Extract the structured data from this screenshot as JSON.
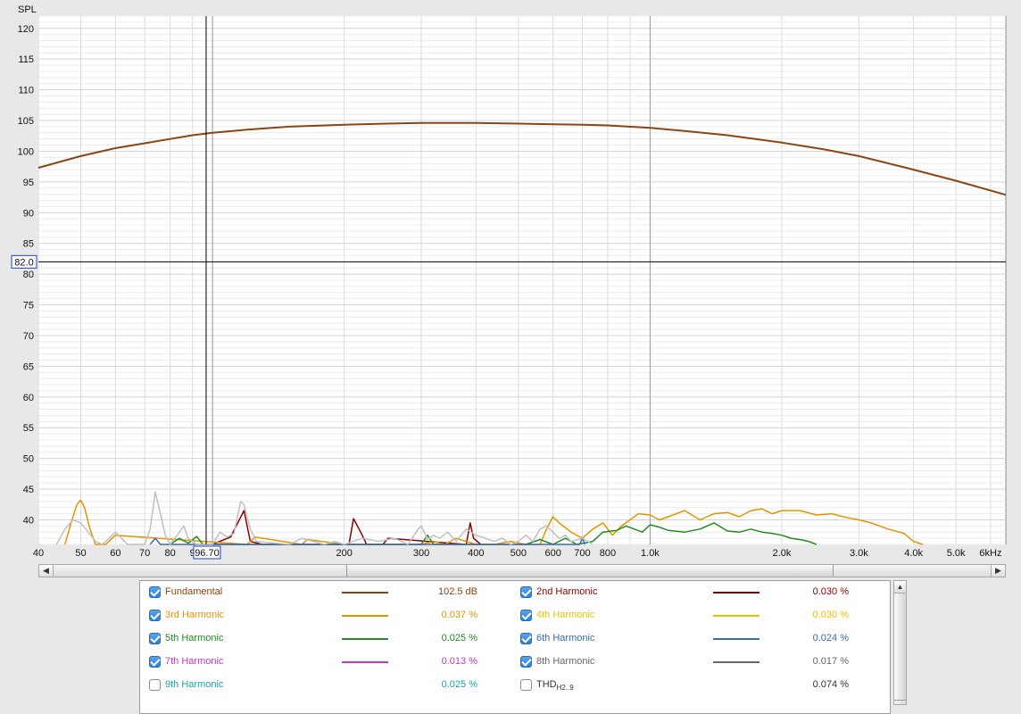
{
  "chart_data": {
    "type": "line",
    "ylabel": "SPL",
    "x_scale": "log",
    "xlim": [
      40,
      6500
    ],
    "ylim": [
      36,
      122
    ],
    "x_ticks": [
      {
        "v": 40,
        "label": "40"
      },
      {
        "v": 50,
        "label": "50"
      },
      {
        "v": 60,
        "label": "60"
      },
      {
        "v": 70,
        "label": "70"
      },
      {
        "v": 80,
        "label": "80"
      },
      {
        "v": 90,
        "label": "9"
      },
      {
        "v": 200,
        "label": "200"
      },
      {
        "v": 300,
        "label": "300"
      },
      {
        "v": 400,
        "label": "400"
      },
      {
        "v": 500,
        "label": "500"
      },
      {
        "v": 600,
        "label": "600"
      },
      {
        "v": 700,
        "label": "700"
      },
      {
        "v": 800,
        "label": "800"
      },
      {
        "v": 1000,
        "label": "1.0k"
      },
      {
        "v": 2000,
        "label": "2.0k"
      },
      {
        "v": 3000,
        "label": "3.0k"
      },
      {
        "v": 4000,
        "label": "4.0k"
      },
      {
        "v": 5000,
        "label": "5.0k"
      },
      {
        "v": 6000,
        "label": "6kHz"
      }
    ],
    "y_ticks": [
      {
        "v": 40,
        "label": "40"
      },
      {
        "v": 45,
        "label": "45"
      },
      {
        "v": 50,
        "label": "50"
      },
      {
        "v": 55,
        "label": "55"
      },
      {
        "v": 60,
        "label": "60"
      },
      {
        "v": 65,
        "label": "65"
      },
      {
        "v": 70,
        "label": "70"
      },
      {
        "v": 75,
        "label": "75"
      },
      {
        "v": 80,
        "label": "80"
      },
      {
        "v": 85,
        "label": "85"
      },
      {
        "v": 90,
        "label": "90"
      },
      {
        "v": 95,
        "label": "95"
      },
      {
        "v": 100,
        "label": "100"
      },
      {
        "v": 105,
        "label": "105"
      },
      {
        "v": 110,
        "label": "110"
      },
      {
        "v": 115,
        "label": "115"
      },
      {
        "v": 120,
        "label": "120"
      }
    ],
    "cursor": {
      "x": 96.7,
      "y": 82.0,
      "x_label": "96.70",
      "y_label": "82.0"
    },
    "series": [
      {
        "name": "Fundamental",
        "color": "#8b4513",
        "x": [
          40,
          50,
          60,
          70,
          80,
          90,
          100,
          120,
          150,
          200,
          250,
          300,
          400,
          500,
          600,
          700,
          800,
          1000,
          1200,
          1500,
          2000,
          2500,
          3000,
          4000,
          5000,
          6500
        ],
        "y": [
          97.3,
          99.2,
          100.5,
          101.3,
          102.0,
          102.6,
          103.0,
          103.5,
          104.0,
          104.3,
          104.5,
          104.6,
          104.6,
          104.5,
          104.4,
          104.3,
          104.2,
          103.8,
          103.3,
          102.6,
          101.4,
          100.3,
          99.2,
          97.0,
          95.2,
          92.9
        ]
      },
      {
        "name": "2nd Harmonic",
        "color": "#8b0000",
        "x": [
          100,
          110,
          118,
          122,
          130,
          140,
          205,
          210,
          218,
          225,
          245,
          252,
          380,
          388,
          395,
          410
        ],
        "y": [
          36,
          37.2,
          41.5,
          36.5,
          36,
          36,
          36,
          40.2,
          38.0,
          36,
          36,
          37.0,
          36,
          39.5,
          37.0,
          36
        ]
      },
      {
        "name": "3rd Harmonic",
        "color": "#e59400",
        "x": [
          46,
          47.5,
          49,
          50,
          51,
          52.5,
          54,
          57,
          60,
          120,
          125,
          160,
          165,
          200,
          230,
          300,
          320,
          340,
          360,
          400,
          440,
          480,
          520,
          560,
          580,
          600,
          620,
          660,
          700,
          740,
          780,
          820,
          860,
          900,
          940,
          1000,
          1050,
          1100,
          1200,
          1300,
          1400,
          1500,
          1600,
          1700,
          1800,
          1900,
          2000,
          2200,
          2400,
          2600,
          2800,
          3000,
          3200,
          3500,
          3800,
          4000,
          4200
        ],
        "y": [
          36,
          39.5,
          42.5,
          43.2,
          42.0,
          38.5,
          36,
          36,
          37.5,
          36,
          37.2,
          36,
          36.8,
          36,
          36,
          36,
          36.5,
          36,
          37.0,
          36,
          36,
          36.5,
          36,
          36,
          38.5,
          40.5,
          39.5,
          38.0,
          37.0,
          38.5,
          39.5,
          37.5,
          39.0,
          40.0,
          41.0,
          40.8,
          40.0,
          40.5,
          41.5,
          40.0,
          41.0,
          41.2,
          40.5,
          41.5,
          41.8,
          41.0,
          41.5,
          41.5,
          40.8,
          41.0,
          40.4,
          40.0,
          39.5,
          38.5,
          37.8,
          36.5,
          36
        ]
      },
      {
        "name": "4th Harmonic",
        "color": "#e6c400",
        "x": [],
        "y": []
      },
      {
        "name": "5th Harmonic",
        "color": "#228b22",
        "x": [
          80,
          84,
          88,
          92,
          95,
          300,
          310,
          320,
          500,
          520,
          560,
          600,
          640,
          680,
          740,
          780,
          840,
          880,
          920,
          960,
          1000,
          1050,
          1100,
          1200,
          1300,
          1400,
          1500,
          1600,
          1700,
          1800,
          1900,
          2000,
          2100,
          2200,
          2300,
          2400
        ],
        "y": [
          36,
          37.0,
          36.2,
          37.3,
          36,
          36,
          37.5,
          36,
          36,
          36,
          36.8,
          36,
          37.0,
          36,
          36.5,
          38.0,
          38.3,
          39.0,
          38.5,
          38.0,
          39.2,
          38.8,
          38.3,
          38.0,
          38.5,
          39.5,
          38.2,
          38.0,
          38.5,
          38.0,
          37.8,
          37.5,
          37.0,
          36.8,
          36.5,
          36
        ]
      },
      {
        "name": "6th Harmonic",
        "color": "#3a6ab0",
        "x": [
          72,
          74,
          76,
          690,
          700,
          710
        ],
        "y": [
          36,
          37.0,
          36,
          36,
          37.0,
          36
        ]
      },
      {
        "name": "7th Harmonic",
        "color": "#cc33cc",
        "x": [],
        "y": []
      },
      {
        "name": "8th Harmonic",
        "color": "#666666",
        "x": [],
        "y": []
      },
      {
        "name": "",
        "color": "#c0c0c0",
        "x": [
          44,
          46,
          48,
          50,
          52,
          54,
          56,
          58,
          60,
          62,
          64,
          70,
          72,
          74,
          76,
          78,
          80,
          84,
          86,
          88,
          92,
          100,
          104,
          108,
          112,
          116,
          118,
          122,
          126,
          150,
          160,
          170,
          180,
          190,
          200,
          220,
          240,
          260,
          280,
          295,
          300,
          310,
          320,
          330,
          345,
          360,
          380,
          400,
          420,
          440,
          460,
          480,
          500,
          520,
          540,
          560,
          580,
          600,
          620,
          640,
          660,
          700,
          740
        ],
        "y": [
          36,
          38.5,
          40.0,
          39.5,
          38.0,
          36.5,
          36,
          37.0,
          38.0,
          37.0,
          36,
          36,
          38.5,
          44.5,
          41.0,
          37.5,
          36,
          38.0,
          39.0,
          37.0,
          36,
          36,
          38.0,
          37.2,
          37.8,
          43.0,
          42.5,
          38.5,
          36.5,
          36,
          37.0,
          36.5,
          36,
          36.5,
          36,
          37.0,
          36.5,
          37.0,
          36,
          38.5,
          39.0,
          36.8,
          37.5,
          37.0,
          38.0,
          36.5,
          38.5,
          37.5,
          37.0,
          36.5,
          37.0,
          36,
          36.5,
          37.5,
          36.5,
          38.5,
          39.0,
          38.0,
          37.0,
          37.5,
          36.5,
          37.0,
          36
        ]
      }
    ]
  },
  "legend": {
    "rows": [
      {
        "name": "Fundamental",
        "value": "102.5 dB",
        "color": "#8b4513",
        "checked": true
      },
      {
        "name": "2nd Harmonic",
        "value": "0.030 %",
        "color": "#8b0000",
        "checked": true
      },
      {
        "name": "3rd Harmonic",
        "value": "0.037 %",
        "color": "#e59400",
        "checked": true
      },
      {
        "name": "4th Harmonic",
        "value": "0.030 %",
        "color": "#e6c400",
        "checked": true
      },
      {
        "name": "5th Harmonic",
        "value": "0.025 %",
        "color": "#228b22",
        "checked": true
      },
      {
        "name": "6th Harmonic",
        "value": "0.024 %",
        "color": "#3a6ab0",
        "checked": true
      },
      {
        "name": "7th Harmonic",
        "value": "0.013 %",
        "color": "#cc33cc",
        "checked": true
      },
      {
        "name": "8th Harmonic",
        "value": "0.017 %",
        "color": "#666666",
        "checked": true
      },
      {
        "name": "9th Harmonic",
        "value": "0.025 %",
        "color": "#1aa3a3",
        "checked": false
      },
      {
        "name": "THD",
        "sub": "H2..9",
        "value": "0.074 %",
        "color": "#333333",
        "checked": false
      }
    ]
  },
  "scroll": {
    "left_arrow": "◀",
    "right_arrow": "▶",
    "up_arrow": "▲"
  }
}
